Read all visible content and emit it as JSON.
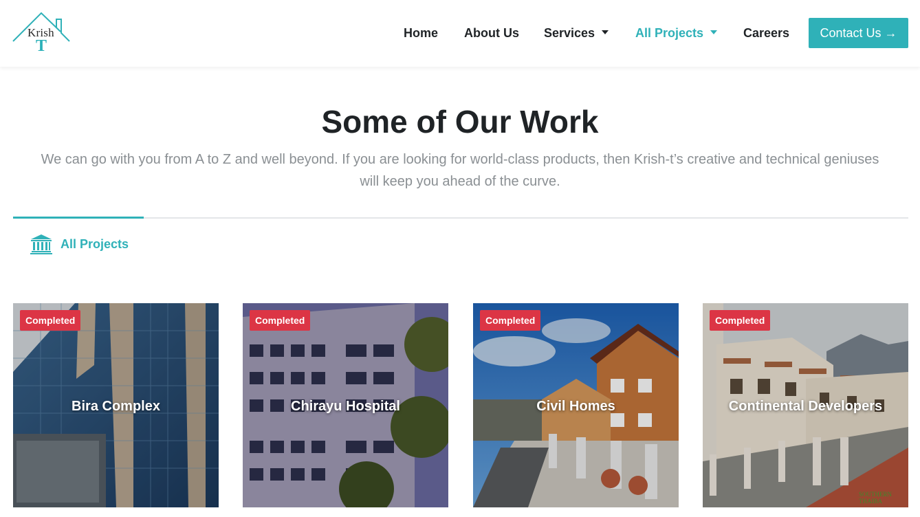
{
  "brand": {
    "logo_text_top": "Krish",
    "logo_text_bottom": "T"
  },
  "nav": {
    "home": "Home",
    "about": "About Us",
    "services": "Services",
    "projects": "All Projects",
    "careers": "Careers",
    "contact": "Contact Us →"
  },
  "colors": {
    "accent": "#2fb1b8",
    "badge": "#dc3545",
    "heading": "#1f2326",
    "muted": "#8a8f93"
  },
  "section": {
    "title": "Some of Our Work",
    "subtitle": "We can go with you from A to Z and well beyond. If you are looking for world-class products, then Krish-t’s creative and technical geniuses will keep you ahead of the curve."
  },
  "tabs": [
    {
      "label": "All Projects",
      "icon": "bank-icon",
      "active": true
    }
  ],
  "projects": [
    {
      "title": "Bira Complex",
      "status": "Completed"
    },
    {
      "title": "Chirayu Hospital",
      "status": "Completed"
    },
    {
      "title": "Civil Homes",
      "status": "Completed"
    },
    {
      "title": "Continental Developers",
      "status": "Completed",
      "watermark": "SOUTHERN THAIBA"
    }
  ]
}
